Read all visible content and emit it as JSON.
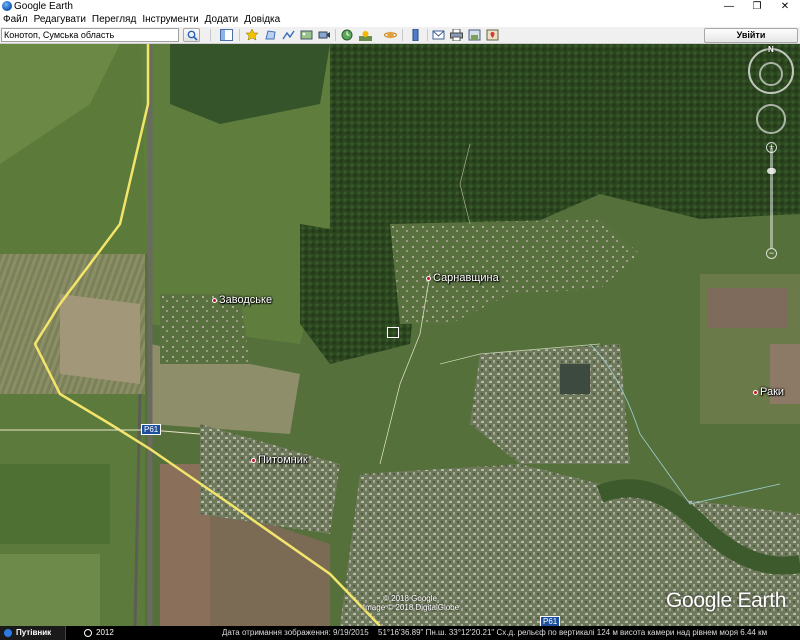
{
  "window": {
    "title": "Google Earth",
    "minimize": "—",
    "maximize": "❐",
    "close": "✕"
  },
  "menu": {
    "items": [
      "Файл",
      "Редагувати",
      "Перегляд",
      "Інструменти",
      "Додати",
      "Довідка"
    ]
  },
  "search": {
    "value": "Конотоп, Сумська область"
  },
  "toolbar": {
    "signin_label": "Увійти"
  },
  "map": {
    "places": [
      {
        "name": "Заводське"
      },
      {
        "name": "Сарнавщина"
      },
      {
        "name": "Питомник"
      },
      {
        "name": "Раки"
      }
    ],
    "road_label": "P61",
    "road_label_2": "P61",
    "copyright_1": "© 2018 Google",
    "copyright_2": "Image © 2018 DigitalGlobe",
    "logo": "Google Earth",
    "compass_north": "N"
  },
  "statusbar": {
    "traveler": "Путівник",
    "history": "2012",
    "imagery_date": "Дата отримання зображення: 9/19/2015",
    "coords": "51°16'36.89\" Пн.ш.  33°12'20.21\" Сх.д.  рельєф по вертикалі  124 м   висота камери над рівнем моря  6.44 км"
  },
  "colors": {
    "forest": "#2f4a22",
    "field": "#7a8450",
    "road": "#f3e46a",
    "pin": "#c8102e",
    "route_shield": "#1d4f9c"
  }
}
